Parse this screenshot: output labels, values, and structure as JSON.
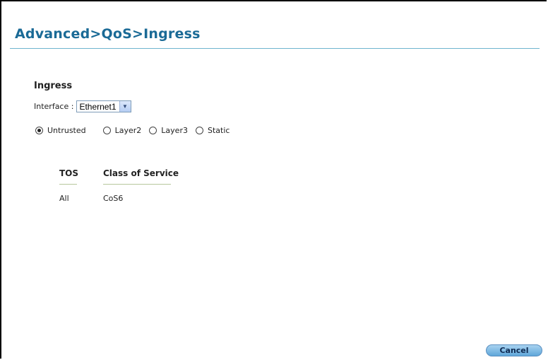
{
  "page": {
    "title": "Advanced>QoS>Ingress",
    "section_heading": "Ingress"
  },
  "interface": {
    "label": "Interface :",
    "selected": "Ethernet1"
  },
  "trust_modes": [
    {
      "label": "Untrusted",
      "selected": true
    },
    {
      "label": "Layer2",
      "selected": false
    },
    {
      "label": "Layer3",
      "selected": false
    },
    {
      "label": "Static",
      "selected": false
    }
  ],
  "table": {
    "columns": [
      "TOS",
      "Class of Service"
    ],
    "rows": [
      [
        "All",
        "CoS6"
      ]
    ]
  },
  "actions": {
    "cancel_label": "Cancel"
  },
  "colors": {
    "title": "#1a6a96",
    "rule": "#6fb5cf",
    "button": "#5fa7da"
  }
}
